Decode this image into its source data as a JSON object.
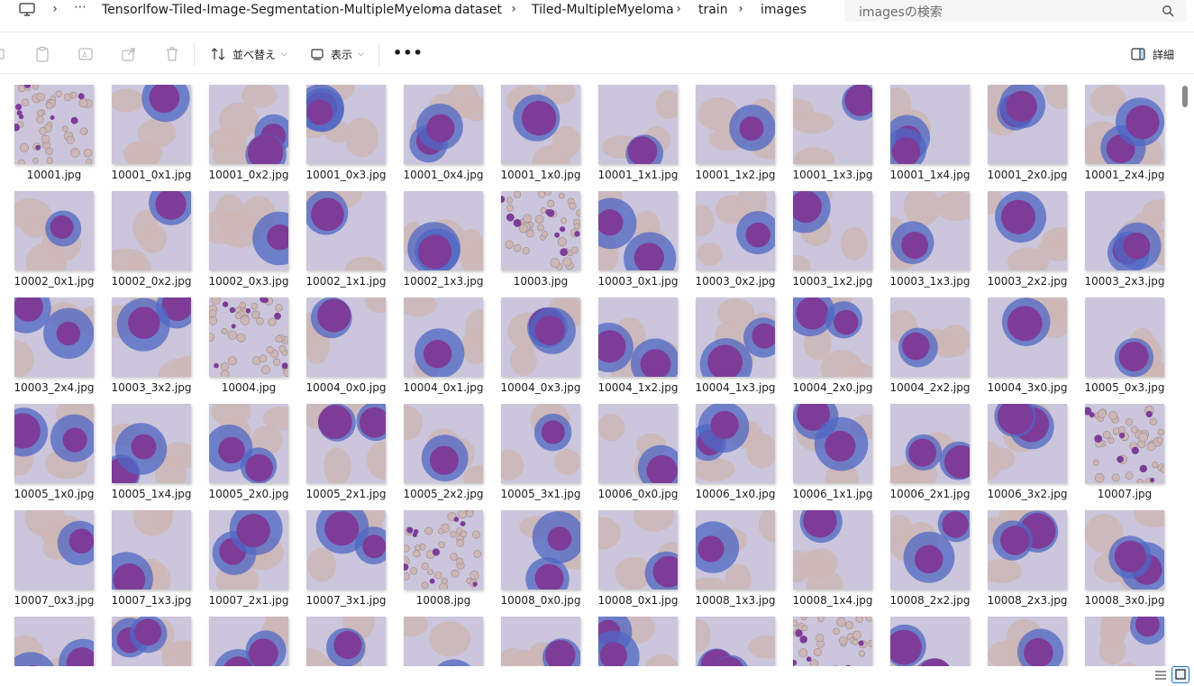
{
  "breadcrumbs": {
    "overflow": "⋯",
    "items": [
      "Tensorlfow-Tiled-Image-Segmentation-MultipleMyeloma",
      "dataset",
      "Tiled-MultipleMyeloma",
      "train",
      "images"
    ]
  },
  "search": {
    "placeholder": "imagesの検索"
  },
  "toolbar": {
    "sort_label": "並べ替え",
    "view_label": "表示",
    "more_label": "•••",
    "details_label": "詳細"
  },
  "files": [
    "10001.jpg",
    "10001_0x1.jpg",
    "10001_0x2.jpg",
    "10001_0x3.jpg",
    "10001_0x4.jpg",
    "10001_1x0.jpg",
    "10001_1x1.jpg",
    "10001_1x2.jpg",
    "10001_1x3.jpg",
    "10001_1x4.jpg",
    "10001_2x0.jpg",
    "10001_2x4.jpg",
    "10002_0x1.jpg",
    "10002_0x2.jpg",
    "10002_0x3.jpg",
    "10002_1x1.jpg",
    "10002_1x3.jpg",
    "10003.jpg",
    "10003_0x1.jpg",
    "10003_0x2.jpg",
    "10003_1x2.jpg",
    "10003_1x3.jpg",
    "10003_2x2.jpg",
    "10003_2x3.jpg",
    "10003_2x4.jpg",
    "10003_3x2.jpg",
    "10004.jpg",
    "10004_0x0.jpg",
    "10004_0x1.jpg",
    "10004_0x3.jpg",
    "10004_1x2.jpg",
    "10004_1x3.jpg",
    "10004_2x0.jpg",
    "10004_2x2.jpg",
    "10004_3x0.jpg",
    "10005_0x3.jpg",
    "10005_1x0.jpg",
    "10005_1x4.jpg",
    "10005_2x0.jpg",
    "10005_2x1.jpg",
    "10005_2x2.jpg",
    "10005_3x1.jpg",
    "10006_0x0.jpg",
    "10006_1x0.jpg",
    "10006_1x1.jpg",
    "10006_2x1.jpg",
    "10006_3x2.jpg",
    "10007.jpg",
    "10007_0x3.jpg",
    "10007_1x3.jpg",
    "10007_2x1.jpg",
    "10007_3x1.jpg",
    "10008.jpg",
    "10008_0x0.jpg",
    "10008_0x1.jpg",
    "10008_1x3.jpg",
    "10008_1x4.jpg",
    "10008_2x2.jpg",
    "10008_2x3.jpg",
    "10008_3x0.jpg"
  ],
  "partial_row_count": 12,
  "colors": {
    "background": "#cbc6dc",
    "cell_purple": "#7d3c98",
    "cell_blue": "#4f67c4",
    "rbc": "#cdb6b6",
    "accent": "#1a73c8"
  }
}
